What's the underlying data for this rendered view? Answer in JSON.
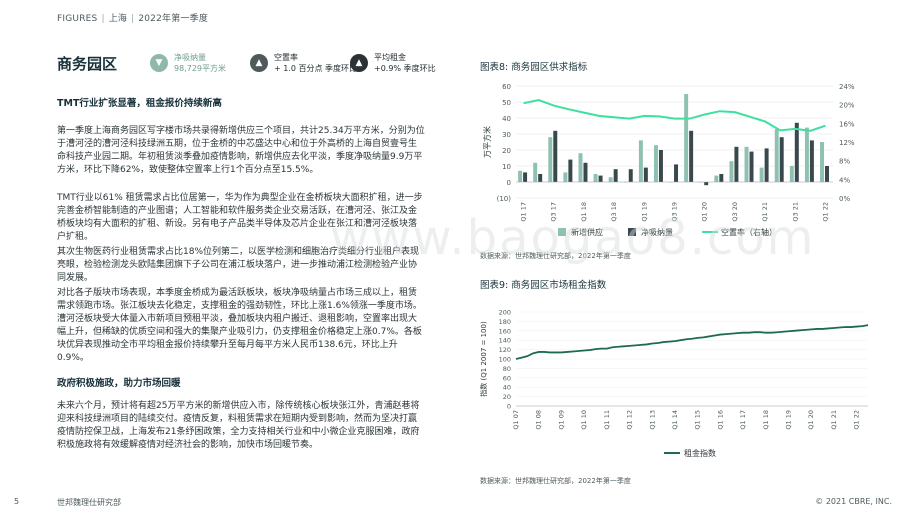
{
  "header": {
    "figures": "FIGURES",
    "sep": "|",
    "market": "上海",
    "period": "2022年第一季度"
  },
  "section_title": "商务园区",
  "kpis": [
    {
      "icon": "arrow-down-icon",
      "label": "净吸纳量",
      "value": "98,729平方米",
      "color": "#8fb8ad"
    },
    {
      "icon": "arrow-up-icon",
      "label": "空置率",
      "value": "+ 1.0 百分点 季度环比",
      "color": "#4f5a5c"
    },
    {
      "icon": "arrow-up-icon",
      "label": "平均租金",
      "value": "+0.9% 季度环比",
      "color": "#2a3234"
    }
  ],
  "body": {
    "h1": "TMT行业扩张显著，租金报价持续新高",
    "p1": "第一季度上海商务园区写字楼市场共录得新增供应三个项目，共计25.34万平方米，分别为位于漕河泾的漕河泾科技绿洲五期，位于金桥的中芯盛达中心和位于外高桥的上海自贸壹号生命科技产业园二期。年初租赁淡季叠加疫情影响，新增供应去化平淡，季度净吸纳量9.9万平方米，环比下降62%，致使整体空置率上行1个百分点至15.5%。",
    "p2": "TMT行业以61% 租赁需求占比位居第一，华为作为典型企业在金桥板块大面积扩租，进一步完善金桥智能制造的产业图谱；人工智能和软件服务类企业交易活跃，在漕河泾、张江及金桥板块均有大面积的扩租、新设。另有电子产品类半导体及芯片企业在张江和漕河泾板块落户扩租。",
    "p3": "其次生物医药行业租赁需求占比18%位列第二，以医学检测和细胞治疗类细分行业租户表现亮眼，检验检测龙头欧陆集团旗下子公司在浦江板块落户，进一步推动浦江检测检验产业协同发展。",
    "p4": "对比各子版块市场表现，本季度金桥成为最活跃板块，板块净吸纳量占市场三成以上，租赁需求领跑市场。张江板块去化稳定，支撑租金的强劲韧性，环比上涨1.6%领涨一季度市场。漕河泾板块受大体量入市新项目预租平淡，叠加板块内租户搬迁、退租影响，空置率出现大幅上升，但稀缺的优质空间和强大的集聚产业吸引力，仍支撑租金价格稳定上涨0.7%。各板块优异表现推动全市平均租金报价持续攀升至每月每平方米人民币138.6元，环比上升0.9%。",
    "h2": "政府积极施政，助力市场回暖",
    "p5": "未来六个月，预计将有超25万平方米的新增供应入市，除传统核心板块张江外，青浦赵巷将迎来科技绿洲项目的陆续交付。疫情反复，料租赁需求在短期内受到影响，然而为坚决打赢疫情防控保卫战，上海发布21条纾困政策，全力支持相关行业和中小微企业克服困难，政府积极施政将有效缓解疫情对经济社会的影响，加快市场回暖节奏。"
  },
  "chart8": {
    "title": "图表8:  商务园区供求指标",
    "ylabel": "万平方米",
    "source": "数据来源：世邦魏理仕研究部，2022年第一季度"
  },
  "chart9": {
    "title": "图表9:  商务园区市场租金指数",
    "ylabel": "指数 (Q1 2007 = 100)",
    "source": "数据来源：世邦魏理仕研究部，2022年第一季度"
  },
  "chart_data": [
    {
      "type": "bar",
      "title": "图表8:  商务园区供求指标",
      "ylabel": "万平方米",
      "ylim": [
        -10,
        60
      ],
      "y2lim": [
        0,
        24
      ],
      "yticks": [
        "(10)",
        "0",
        "10",
        "20",
        "30",
        "40",
        "50",
        "60"
      ],
      "y2ticks": [
        "0%",
        "4%",
        "8%",
        "12%",
        "16%",
        "20%",
        "24%"
      ],
      "categories": [
        "Q1 17",
        "Q2 17",
        "Q3 17",
        "Q4 17",
        "Q1 18",
        "Q2 18",
        "Q3 18",
        "Q4 18",
        "Q1 19",
        "Q2 19",
        "Q3 19",
        "Q4 19",
        "Q1 20",
        "Q2 20",
        "Q3 20",
        "Q4 20",
        "Q1 21",
        "Q2 21",
        "Q3 21",
        "Q4 21",
        "Q1 22"
      ],
      "xtick_labels": [
        "Q1 17",
        "Q3 17",
        "Q1 18",
        "Q3 18",
        "Q1 19",
        "Q3 19",
        "Q1 20",
        "Q3 20",
        "Q1 21",
        "Q3 21",
        "Q1 22"
      ],
      "series": [
        {
          "name": "新增供应",
          "kind": "bar",
          "color": "#8fc1b1",
          "values": [
            7,
            12,
            28,
            6,
            18,
            5,
            3,
            0,
            26,
            23,
            0,
            55,
            0,
            4,
            13,
            22,
            9,
            33,
            10,
            34,
            25
          ]
        },
        {
          "name": "净吸纳量",
          "kind": "bar",
          "color": "#39484c",
          "values": [
            6,
            5,
            32,
            14,
            12,
            4,
            8,
            8,
            9,
            20,
            11,
            32,
            -2,
            5,
            22,
            19,
            21,
            28,
            37,
            26,
            10
          ]
        },
        {
          "name": "空置率（右轴）",
          "kind": "line",
          "color": "#3ee0a0",
          "axis": "right",
          "values": [
            20.3,
            21.0,
            19.8,
            19.0,
            18.3,
            17.6,
            17.3,
            17.0,
            17.6,
            17.5,
            17.0,
            17.0,
            17.9,
            18.6,
            18.4,
            17.4,
            16.4,
            14.5,
            14.8,
            14.4,
            15.5
          ]
        }
      ],
      "legend": "bottom"
    },
    {
      "type": "line",
      "title": "图表9:  商务园区市场租金指数",
      "ylabel": "指数 (Q1 2007 = 100)",
      "ylim": [
        0,
        200
      ],
      "yticks": [
        "0",
        "20",
        "40",
        "60",
        "80",
        "100",
        "120",
        "140",
        "160",
        "180",
        "200"
      ],
      "xtick_labels": [
        "Q1 07",
        "Q1 08",
        "Q1 09",
        "Q1 10",
        "Q1 11",
        "Q1 12",
        "Q1 13",
        "Q1 14",
        "Q1 15",
        "Q1 16",
        "Q1 17",
        "Q1 18",
        "Q1 19",
        "Q1 20",
        "Q1 21",
        "Q1 22"
      ],
      "series": [
        {
          "name": "租金指数",
          "color": "#1f6b4f",
          "values": [
            100,
            103,
            106,
            112,
            115,
            115,
            114,
            114,
            114,
            115,
            116,
            117,
            118,
            119,
            121,
            122,
            122,
            125,
            126,
            127,
            128,
            129,
            130,
            131,
            133,
            134,
            136,
            137,
            138,
            140,
            142,
            143,
            145,
            146,
            148,
            150,
            152,
            153,
            154,
            155,
            156,
            156,
            157,
            157,
            156,
            156,
            157,
            158,
            159,
            160,
            161,
            162,
            163,
            164,
            164,
            165,
            166,
            167,
            168,
            168,
            169,
            170,
            172
          ]
        }
      ],
      "legend": "bottom"
    }
  ],
  "footer": {
    "page": "5",
    "org": "世邦魏理仕研究部",
    "copyright": "© 2021 CBRE, INC."
  },
  "watermark": "www.baogao8.com"
}
